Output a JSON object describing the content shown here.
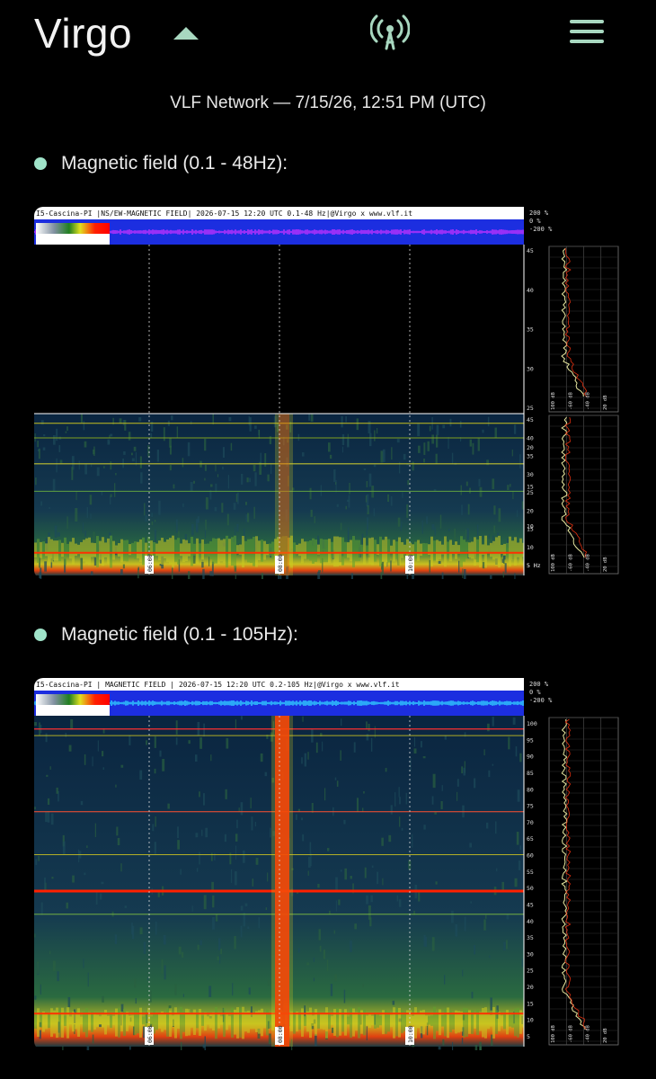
{
  "header": {
    "title": "Virgo",
    "icons": {
      "collapse": "chevron-up-icon",
      "broadcast": "broadcast-icon",
      "menu": "hamburger-menu-icon"
    }
  },
  "subtitle": "VLF Network — 7/15/26, 12:51 PM (UTC)",
  "colors": {
    "accent": "#9fe3c9",
    "background": "#000000"
  },
  "sections": [
    {
      "label": "Magnetic field (0.1 - 48Hz):",
      "banner": "I5-Cascina-PI |NS/EW-MAGNETIC FIELD| 2026-07-15 12:20 UTC 0.1-48 Hz|@Virgo x www.vlf.it",
      "scale": {
        "a": "-100 dB",
        "b": "-50",
        "c": "0"
      },
      "amp": [
        "200 %",
        "0 %",
        "-200 %"
      ],
      "yticks": [
        "45",
        "40",
        "35",
        "30",
        "25",
        "20",
        "15",
        "10",
        "5 Hz"
      ],
      "sideticks": [
        "100 dB",
        "-60 dB",
        "-40 dB",
        "20 dB"
      ],
      "times": [
        "06:00",
        "08:00",
        "10:00"
      ]
    },
    {
      "label": "Magnetic field (0.1 - 105Hz):",
      "banner": "I5-Cascina-PI | MAGNETIC FIELD | 2026-07-15 12:20 UTC 0.2-105 Hz|@Virgo x www.vlf.it",
      "scale": {
        "a": "-100 dB",
        "b": "-50",
        "c": "0"
      },
      "amp": [
        "200 %",
        "0 %",
        "-200 %"
      ],
      "yticks": [
        "100",
        "95",
        "90",
        "85",
        "80",
        "75",
        "70",
        "65",
        "60",
        "55",
        "50",
        "45",
        "40",
        "35",
        "30",
        "25",
        "20",
        "15",
        "10",
        "5"
      ],
      "sideticks": [
        "100 dB",
        "-60 dB",
        "-40 dB",
        "20 dB"
      ],
      "times": [
        "06:00",
        "08:00",
        "10:00"
      ]
    }
  ]
}
